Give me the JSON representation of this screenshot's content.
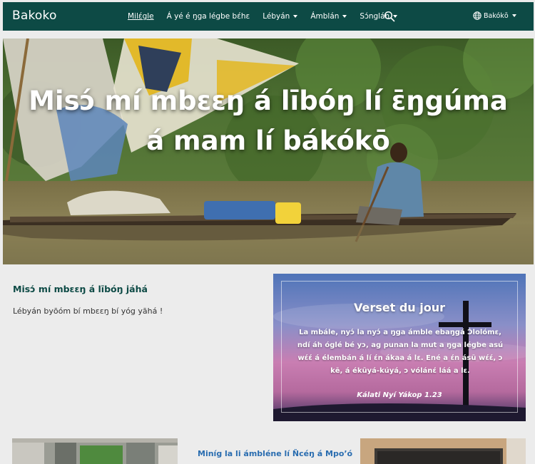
{
  "header": {
    "brand": "Bakoko",
    "nav": [
      {
        "label": "Milέgle",
        "dropdown": false,
        "active": true
      },
      {
        "label": "Á yé é ŋga légbe bέhɛ",
        "dropdown": false,
        "active": false
      },
      {
        "label": "Lébyán",
        "dropdown": true,
        "active": false
      },
      {
        "label": "Ámblán",
        "dropdown": true,
        "active": false
      },
      {
        "label": "Sɔ́nglán",
        "dropdown": true,
        "active": false
      }
    ],
    "search_icon": "search-icon",
    "language": "Bakókō",
    "language_icon": "globe-icon"
  },
  "hero": {
    "title_line1": "Misɔ́ mí mbɛɛŋ á lībóŋ lí ɛ̄ŋgúma",
    "title_line2": "á mam lí bákókō"
  },
  "main": {
    "section_title": "Misɔ́ mí mbɛɛŋ á lībóŋ jáhá",
    "section_text": "Lébyán byōóm bí mbɛɛŋ bí yóg yāhá !"
  },
  "verse": {
    "heading": "Verset du jour",
    "text": "La mbále, nyɔ́ la nyɔ́ a ŋga ámble ebaŋgá Ɔ́lolómɛ, ndí áh óglé bé yɔ, ag punan la mut a ŋga légbe asú wέέ á élembán á lí έn ákaa á lɛ. Ené a έn ásū wέέ, ɔ kē, á ékūyá-kúyá, ɔ vólánέ láá a lɛ.",
    "reference": "Kálati Nyí Yákop 1.23"
  },
  "news": {
    "title": "Miníg la li ámbléne lí Ñcéŋ á Mpo’ó"
  },
  "colors": {
    "header_bg": "#0d4a45",
    "title_accent": "#0d4a45",
    "link": "#2a6db0",
    "page_bg": "#ececec"
  }
}
